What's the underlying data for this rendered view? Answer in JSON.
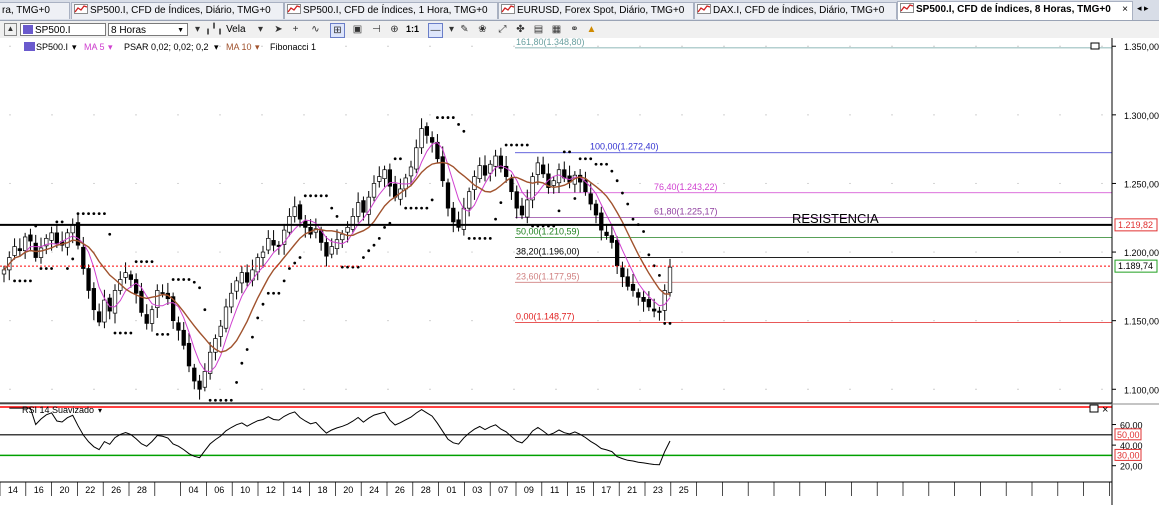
{
  "tabs": [
    {
      "label": "ra, TMG+0",
      "active": false
    },
    {
      "label": "SP500.I, CFD de Índices, Diário, TMG+0",
      "active": false
    },
    {
      "label": "SP500.I, CFD de Índices, 1 Hora, TMG+0",
      "active": false
    },
    {
      "label": "EURUSD, Forex Spot, Diário, TMG+0",
      "active": false
    },
    {
      "label": "DAX.I, CFD de Índices, Diário, TMG+0",
      "active": false
    },
    {
      "label": "SP500.I, CFD de Índices, 8 Horas, TMG+0",
      "active": true
    }
  ],
  "tab_close": "×",
  "tab_nav": "◂ ▸",
  "toolbar": {
    "symbol": "SP500.I",
    "period": "8 Horas",
    "chart_type": "Vela",
    "zoom_label": "1:1"
  },
  "legend": {
    "symbol": "SP500.I",
    "ma5": "MA 5",
    "psar": "PSAR 0,02; 0,02; 0,2",
    "ma10": "MA 10",
    "fib": "Fibonacci 1"
  },
  "colors": {
    "ma5": "#d040d0",
    "ma10": "#a0522d",
    "psar": "#000000",
    "candle_up": "#ffffff",
    "candle_down": "#000000",
    "resistance_line": "#000000",
    "current_price_line": "#ff0000",
    "rsi_line": "#000000",
    "rsi_upper": "#ff0000",
    "rsi_lower": "#00a000"
  },
  "annotations": {
    "resistance_text": "RESISTENCIA"
  },
  "fibonacci": [
    {
      "label": "161,80(1.348,80)",
      "price": 1348.8,
      "color": "#6aa0a0"
    },
    {
      "label": "100,00(1.272,40)",
      "price": 1272.4,
      "color": "#3030d0"
    },
    {
      "label": "76,40(1.243,22)",
      "price": 1243.22,
      "color": "#d040d0"
    },
    {
      "label": "61,80(1.225,17)",
      "price": 1225.17,
      "color": "#9040a0"
    },
    {
      "label": "50,00(1.210,59)",
      "price": 1210.59,
      "color": "#208020"
    },
    {
      "label": "38,20(1.196,00)",
      "price": 1196.0,
      "color": "#000000"
    },
    {
      "label": "23,60(1.177,95)",
      "price": 1177.95,
      "color": "#d08080"
    },
    {
      "label": "0,00(1.148,77)",
      "price": 1148.77,
      "color": "#e02020"
    }
  ],
  "price_axis": {
    "ticks": [
      "1.350,00",
      "1.300,00",
      "1.250,00",
      "1.200,00",
      "1.150,00",
      "1.100,00"
    ],
    "tick_values": [
      1350,
      1300,
      1250,
      1200,
      1150,
      1100
    ],
    "resistance_tag": "1.219,82",
    "resistance_value": 1219.82,
    "current_tag": "1.189,74",
    "current_value": 1189.74,
    "range": [
      1090,
      1356
    ]
  },
  "rsi": {
    "label": "RSI 14 Suavizado",
    "ticks": [
      "60,00",
      "40,00",
      "20,00"
    ],
    "tick_values": [
      60,
      40,
      20
    ],
    "upper_tag": "50,00",
    "upper_value": 50,
    "lower_tag": "30,00",
    "lower_value": 30,
    "range": [
      10,
      78
    ],
    "panel_close": "×"
  },
  "date_axis": {
    "labels": [
      "14",
      "16",
      "20",
      "22",
      "26",
      "28",
      "",
      "04",
      "06",
      "10",
      "12",
      "14",
      "18",
      "20",
      "24",
      "26",
      "28",
      "01",
      "03",
      "07",
      "09",
      "11",
      "15",
      "17",
      "21",
      "23",
      "25"
    ]
  },
  "chart_data": {
    "type": "candlestick",
    "symbol": "SP500.I",
    "timeframe": "8 Horas",
    "closes": [
      1187,
      1196,
      1204,
      1201,
      1211,
      1208,
      1196,
      1203,
      1210,
      1214,
      1206,
      1205,
      1214,
      1220,
      1205,
      1188,
      1172,
      1158,
      1149,
      1165,
      1157,
      1172,
      1180,
      1185,
      1180,
      1170,
      1156,
      1148,
      1158,
      1172,
      1170,
      1166,
      1150,
      1143,
      1132,
      1117,
      1106,
      1100,
      1113,
      1127,
      1137,
      1146,
      1160,
      1170,
      1179,
      1185,
      1178,
      1187,
      1196,
      1200,
      1210,
      1205,
      1204,
      1216,
      1226,
      1233,
      1224,
      1218,
      1213,
      1217,
      1207,
      1197,
      1204,
      1209,
      1213,
      1218,
      1226,
      1236,
      1229,
      1240,
      1250,
      1255,
      1260,
      1248,
      1240,
      1246,
      1254,
      1262,
      1276,
      1290,
      1285,
      1280,
      1268,
      1252,
      1232,
      1222,
      1218,
      1232,
      1244,
      1255,
      1263,
      1256,
      1264,
      1270,
      1261,
      1255,
      1244,
      1232,
      1227,
      1238,
      1255,
      1265,
      1257,
      1247,
      1252,
      1260,
      1254,
      1251,
      1256,
      1251,
      1244,
      1235,
      1227,
      1216,
      1212,
      1207,
      1190,
      1182,
      1175,
      1172,
      1167,
      1164,
      1160,
      1157,
      1156,
      1172,
      1189
    ]
  }
}
